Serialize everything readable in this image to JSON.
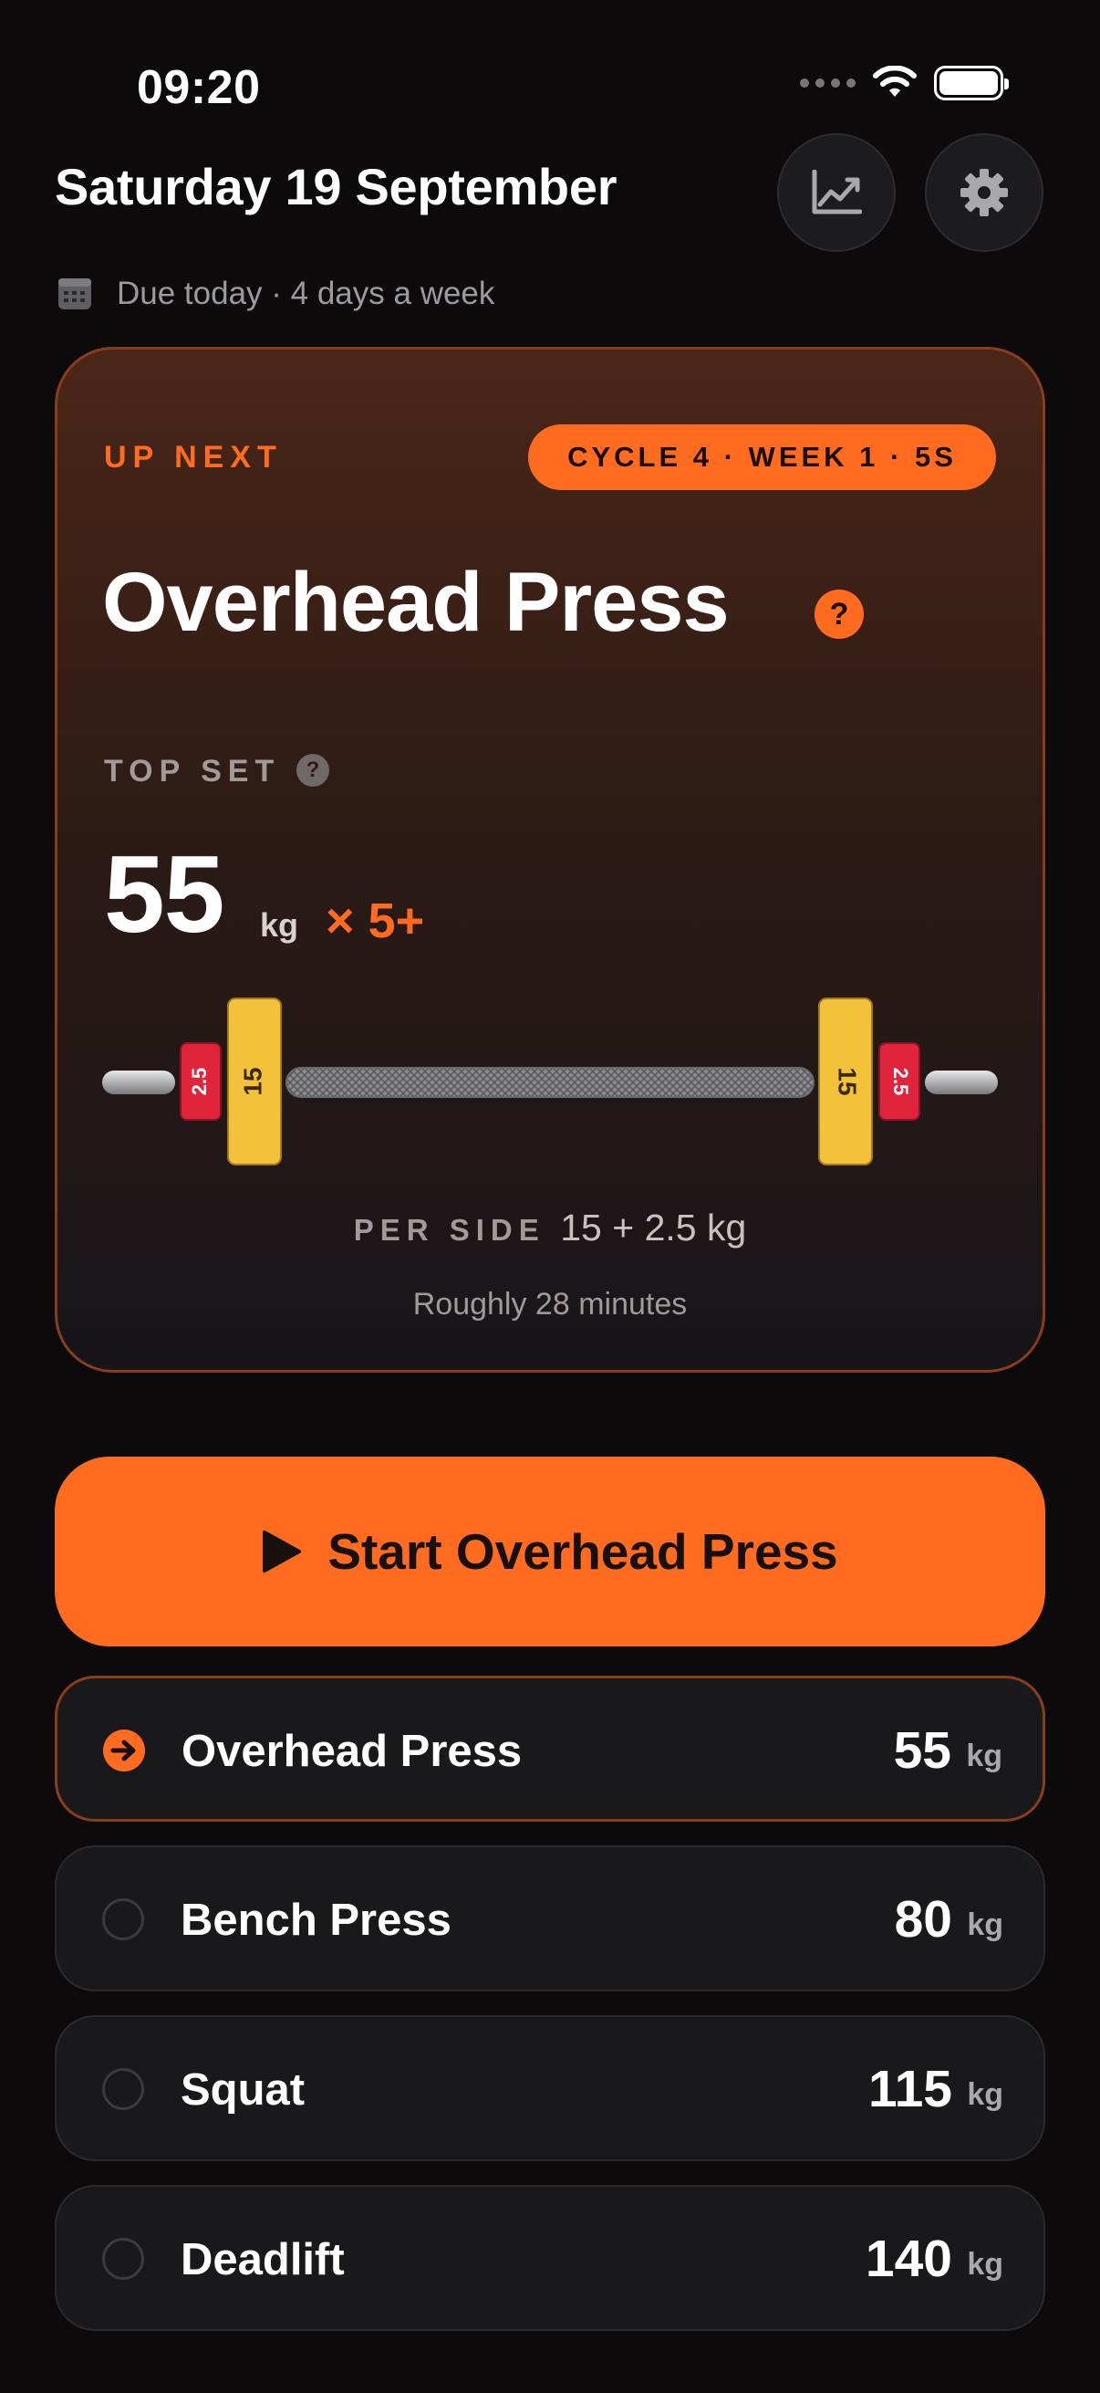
{
  "status": {
    "time": "09:20"
  },
  "header": {
    "title": "Saturday 19 September",
    "due_text": "Due today · 4 days a week"
  },
  "next": {
    "up_next_label": "UP NEXT",
    "cycle_badge": "CYCLE 4 · WEEK 1 · 5S",
    "lift_name": "Overhead Press",
    "help_glyph": "?",
    "top_set_label": "TOP SET",
    "weight": "55",
    "weight_unit": "kg",
    "reps": "× 5+",
    "plates_per_side": [
      "15",
      "2.5"
    ],
    "plate_colors": {
      "15": "#f4c13a",
      "2.5": "#e0243c"
    },
    "per_side_label": "PER SIDE",
    "per_side_value": "15 + 2.5 kg",
    "duration": "Roughly 28 minutes"
  },
  "start_button": {
    "label": "Start Overhead Press"
  },
  "lifts": [
    {
      "name": "Overhead Press",
      "weight": "55",
      "unit": "kg",
      "status": "next"
    },
    {
      "name": "Bench Press",
      "weight": "80",
      "unit": "kg",
      "status": "pending"
    },
    {
      "name": "Squat",
      "weight": "115",
      "unit": "kg",
      "status": "pending"
    },
    {
      "name": "Deadlift",
      "weight": "140",
      "unit": "kg",
      "status": "pending"
    }
  ],
  "colors": {
    "accent": "#ff6b1f",
    "background": "#0c0a0a",
    "card": "#19191c"
  },
  "icons": [
    "wifi-icon",
    "battery-icon",
    "chart-icon",
    "gear-icon",
    "calendar-icon",
    "play-icon",
    "arrow-right-circle-icon",
    "empty-circle-icon"
  ]
}
